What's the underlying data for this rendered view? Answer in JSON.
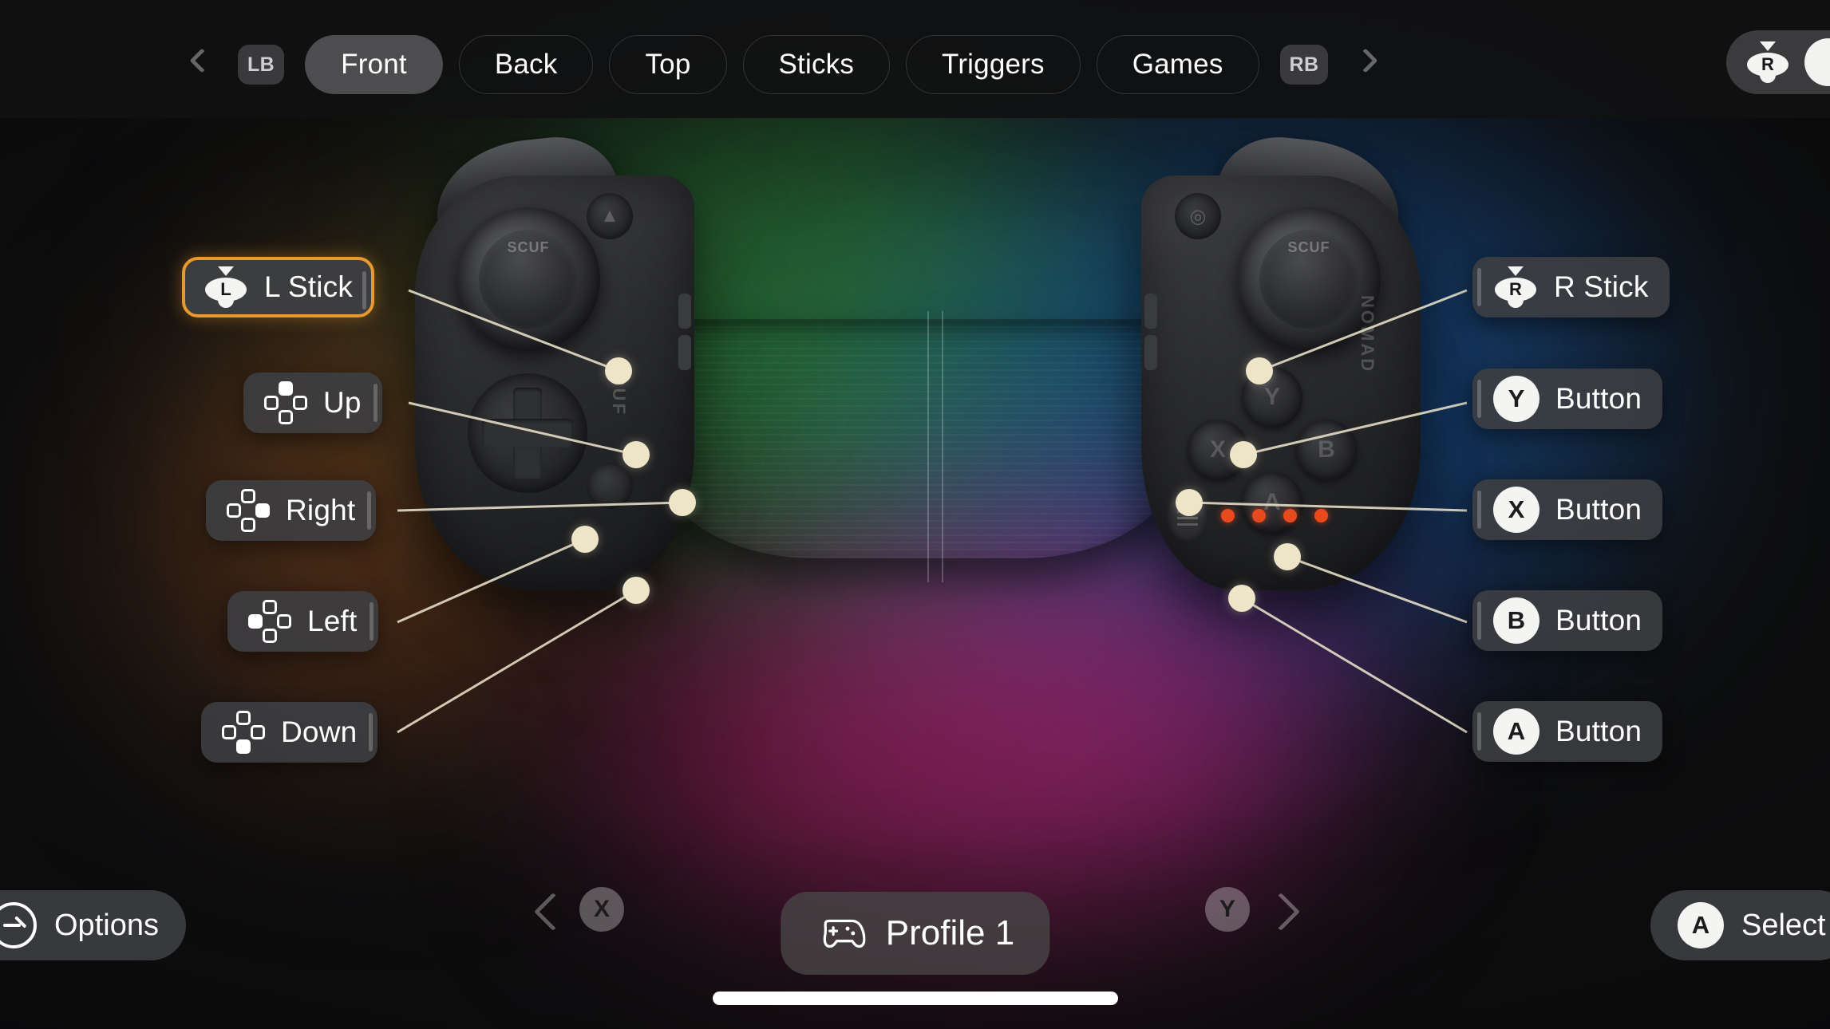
{
  "topbar": {
    "prev_bumper": "LB",
    "next_bumper": "RB",
    "prev_arrow_icon": "chevron-left-icon",
    "next_arrow_icon": "chevron-right-icon",
    "tabs": [
      {
        "label": "Front",
        "active": true
      },
      {
        "label": "Back",
        "active": false
      },
      {
        "label": "Top",
        "active": false
      },
      {
        "label": "Sticks",
        "active": false
      },
      {
        "label": "Triggers",
        "active": false
      },
      {
        "label": "Games",
        "active": false
      }
    ],
    "corner_chip": {
      "stick_letter": "R",
      "icon": "r-stick-icon"
    }
  },
  "device": {
    "brand": "SCUF",
    "model": "NOMAD",
    "stick_cap_text": "SCUF",
    "face_buttons": [
      "Y",
      "X",
      "B",
      "A"
    ],
    "led_count": 4,
    "led_color": "#e8491d"
  },
  "callouts": {
    "left": [
      {
        "id": "l-stick",
        "label": "L Stick",
        "icon": "l-stick-icon",
        "selected": true,
        "dir": ""
      },
      {
        "id": "dp-up",
        "label": "Up",
        "icon": "dpad-up-icon",
        "selected": false,
        "dir": "u"
      },
      {
        "id": "dp-right",
        "label": "Right",
        "icon": "dpad-right-icon",
        "selected": false,
        "dir": "r"
      },
      {
        "id": "dp-left",
        "label": "Left",
        "icon": "dpad-left-icon",
        "selected": false,
        "dir": "l"
      },
      {
        "id": "dp-down",
        "label": "Down",
        "icon": "dpad-down-icon",
        "selected": false,
        "dir": "d"
      }
    ],
    "right": [
      {
        "id": "r-stick",
        "label": "R Stick",
        "icon": "r-stick-icon",
        "badge": ""
      },
      {
        "id": "y-button",
        "label": "Button",
        "icon": "y-badge-icon",
        "badge": "Y"
      },
      {
        "id": "x-button",
        "label": "Button",
        "icon": "x-badge-icon",
        "badge": "X"
      },
      {
        "id": "b-button",
        "label": "Button",
        "icon": "b-badge-icon",
        "badge": "B"
      },
      {
        "id": "a-button",
        "label": "Button",
        "icon": "a-badge-icon",
        "badge": "A"
      }
    ]
  },
  "bottombar": {
    "options_label": "Options",
    "options_icon": "options-circle-icon",
    "profile_label": "Profile 1",
    "profile_icon": "gamepad-icon",
    "prev_button": "X",
    "next_button": "Y",
    "select_label": "Select",
    "select_button": "A"
  },
  "colors": {
    "accent_selected": "#e89b2c",
    "hotspot": "#eee5c9",
    "led": "#e8491d",
    "pill_bg": "#3e3f42",
    "background": "#0e0e0f"
  }
}
